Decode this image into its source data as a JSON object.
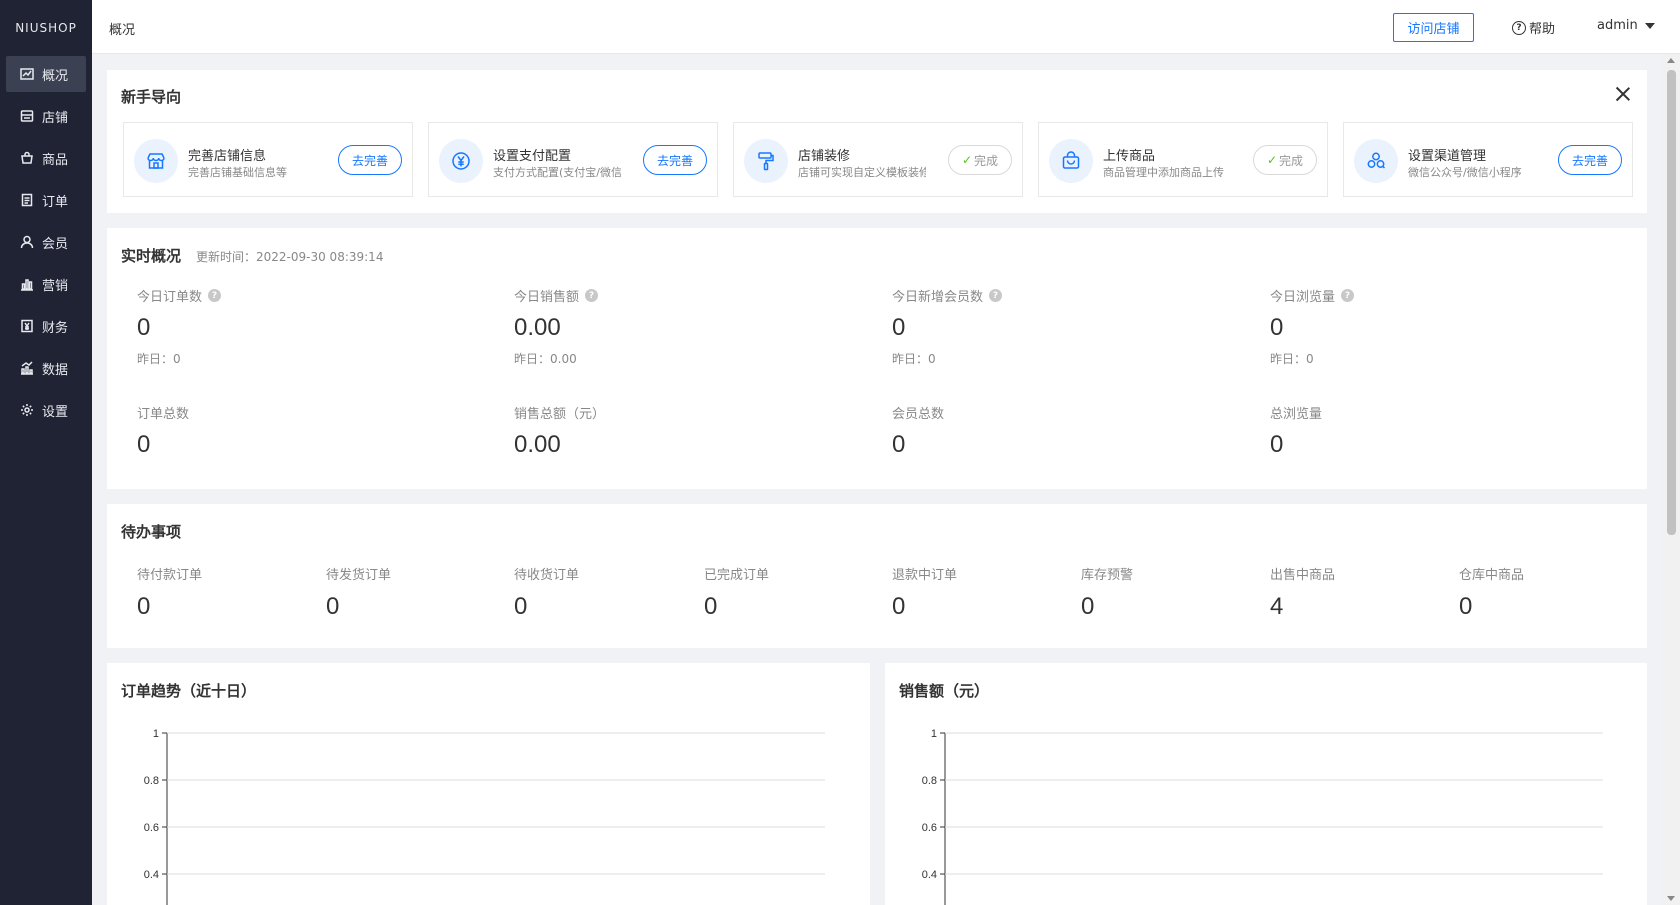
{
  "sidebar": {
    "logo": "NIUSHOP",
    "items": [
      {
        "label": "概况",
        "icon": "chart-line-icon",
        "active": true
      },
      {
        "label": "店铺",
        "icon": "store-icon"
      },
      {
        "label": "商品",
        "icon": "bag-icon"
      },
      {
        "label": "订单",
        "icon": "document-icon"
      },
      {
        "label": "会员",
        "icon": "user-icon"
      },
      {
        "label": "营销",
        "icon": "bar-chart-icon"
      },
      {
        "label": "财务",
        "icon": "yen-document-icon"
      },
      {
        "label": "数据",
        "icon": "analytics-icon"
      },
      {
        "label": "设置",
        "icon": "gear-icon"
      }
    ]
  },
  "header": {
    "title": "概况",
    "visit_store": "访问店铺",
    "help": "帮助",
    "user": "admin"
  },
  "guide": {
    "title": "新手导向",
    "items": [
      {
        "title": "完善店铺信息",
        "desc": "完善店铺基础信息等",
        "action": "去完善",
        "done": false,
        "icon": "store-icon"
      },
      {
        "title": "设置支付配置",
        "desc": "支付方式配置(支付宝/微信)",
        "action": "去完善",
        "done": false,
        "icon": "yen-circle-icon"
      },
      {
        "title": "店铺装修",
        "desc": "店铺可实现自定义模板装修",
        "action": "完成",
        "done": true,
        "icon": "paint-roller-icon"
      },
      {
        "title": "上传商品",
        "desc": "商品管理中添加商品上传",
        "action": "完成",
        "done": true,
        "icon": "shopping-bag-icon"
      },
      {
        "title": "设置渠道管理",
        "desc": "微信公众号/微信小程序",
        "action": "去完善",
        "done": false,
        "icon": "channels-icon"
      }
    ]
  },
  "realtime": {
    "title": "实时概况",
    "updated": "更新时间：2022-09-30 08:39:14",
    "today": [
      {
        "label": "今日订单数",
        "value": "0",
        "yesterday": "昨日：0"
      },
      {
        "label": "今日销售额",
        "value": "0.00",
        "yesterday": "昨日：0.00"
      },
      {
        "label": "今日新增会员数",
        "value": "0",
        "yesterday": "昨日：0"
      },
      {
        "label": "今日浏览量",
        "value": "0",
        "yesterday": "昨日：0"
      }
    ],
    "totals": [
      {
        "label": "订单总数",
        "value": "0"
      },
      {
        "label": "销售总额（元）",
        "value": "0.00"
      },
      {
        "label": "会员总数",
        "value": "0"
      },
      {
        "label": "总浏览量",
        "value": "0"
      }
    ]
  },
  "todo": {
    "title": "待办事项",
    "items": [
      {
        "label": "待付款订单",
        "value": "0"
      },
      {
        "label": "待发货订单",
        "value": "0"
      },
      {
        "label": "待收货订单",
        "value": "0"
      },
      {
        "label": "已完成订单",
        "value": "0"
      },
      {
        "label": "退款中订单",
        "value": "0"
      },
      {
        "label": "库存预警",
        "value": "0"
      },
      {
        "label": "出售中商品",
        "value": "4"
      },
      {
        "label": "仓库中商品",
        "value": "0"
      }
    ]
  },
  "chart_data": [
    {
      "type": "line",
      "title": "订单趋势（近十日）",
      "xlabel": "",
      "ylabel": "",
      "ylim": [
        0,
        1
      ],
      "yticks": [
        "1",
        "0.8",
        "0.6",
        "0.4"
      ],
      "grid": true,
      "series": []
    },
    {
      "type": "line",
      "title": "销售额（元）",
      "xlabel": "",
      "ylabel": "",
      "ylim": [
        0,
        1
      ],
      "yticks": [
        "1",
        "0.8",
        "0.6",
        "0.4"
      ],
      "grid": true,
      "series": []
    }
  ]
}
